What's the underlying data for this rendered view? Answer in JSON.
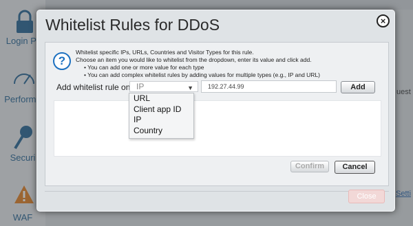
{
  "background": {
    "sidebar_items": [
      "Login Pr",
      "Performa",
      "Securi",
      "WAF"
    ],
    "right_snippets": [
      "uest",
      "Setti"
    ]
  },
  "modal": {
    "title": "Whitelist Rules for DDoS",
    "close_icon": "×",
    "info_icon": "?",
    "info_lines": [
      "Whitelist specific IPs, URLs, Countries and Visitor Types for this rule.",
      "Choose an item you would like to whitelist from the dropdown, enter its value and click add.",
      "• You can add one or more value for each type",
      "• You can add complex whitelist rules by adding values for multiple types (e.g., IP and URL)"
    ],
    "rule_label": "Add whitelist rule on",
    "selected_type": "IP",
    "value": "192.27.44.99",
    "add_label": "Add",
    "confirm_label": "Confirm",
    "cancel_label": "Cancel",
    "close_label": "Close",
    "dropdown_options": [
      "URL",
      "Client app ID",
      "IP",
      "Country"
    ]
  },
  "colors": {
    "accent": "#1c70c0",
    "close_button": "#f2d8d7"
  },
  "icons": {
    "close": "close-icon",
    "info": "info-icon",
    "caret": "chevron-down-icon"
  }
}
